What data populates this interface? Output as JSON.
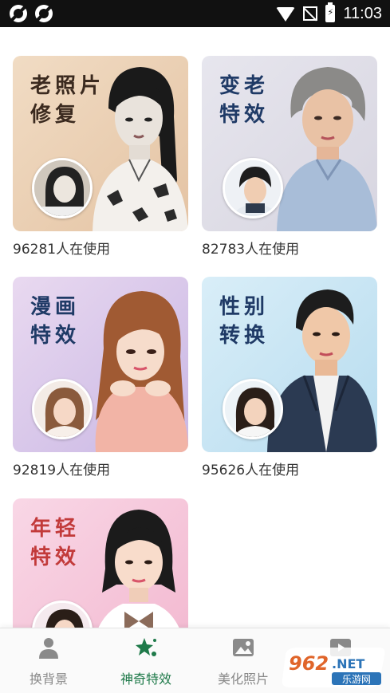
{
  "status_bar": {
    "time": "11:03"
  },
  "cards": [
    {
      "title_line1": "老照片",
      "title_line2": "修复",
      "usage": "96281人在使用"
    },
    {
      "title_line1": "变老",
      "title_line2": "特效",
      "usage": "82783人在使用"
    },
    {
      "title_line1": "漫画",
      "title_line2": "特效",
      "usage": "92819人在使用"
    },
    {
      "title_line1": "性别",
      "title_line2": "转换",
      "usage": "95626人在使用"
    },
    {
      "title_line1": "年轻",
      "title_line2": "特效"
    }
  ],
  "bottom_nav": {
    "items": [
      {
        "label": "换背景",
        "icon": "person-icon"
      },
      {
        "label": "神奇特效",
        "icon": "sparkle-icon",
        "active": true
      },
      {
        "label": "美化照片",
        "icon": "image-icon"
      },
      {
        "label": "",
        "icon": "video-icon"
      }
    ]
  },
  "watermark": {
    "brand": "962.NET",
    "subtitle": "乐游网"
  },
  "colors": {
    "accent": "#1f7a4a",
    "title_brown": "#3b2a1f",
    "title_navy": "#1f3a66",
    "title_red": "#c23a3a"
  }
}
